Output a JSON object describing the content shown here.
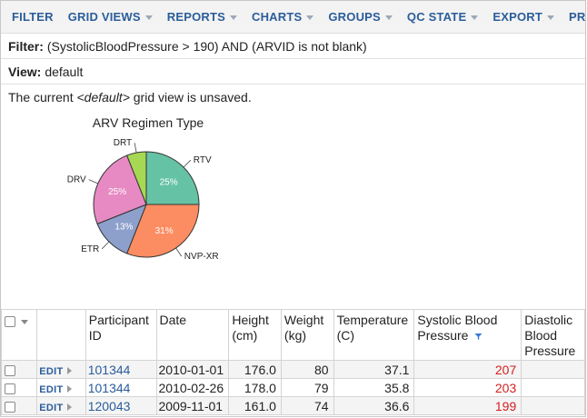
{
  "menu": [
    {
      "label": "FILTER",
      "caret": false
    },
    {
      "label": "GRID VIEWS",
      "caret": true
    },
    {
      "label": "REPORTS",
      "caret": true
    },
    {
      "label": "CHARTS",
      "caret": true
    },
    {
      "label": "GROUPS",
      "caret": true
    },
    {
      "label": "QC STATE",
      "caret": true
    },
    {
      "label": "EXPORT",
      "caret": true
    },
    {
      "label": "PRINT",
      "caret": false
    }
  ],
  "filter": {
    "label": "Filter:",
    "value": "(SystolicBloodPressure > 190) AND (ARVID is not blank)"
  },
  "view": {
    "label": "View:",
    "value": "default"
  },
  "unsaved": {
    "prefix": "The current ",
    "view_name": "<default>",
    "suffix": " grid view is unsaved."
  },
  "chart_data": {
    "type": "pie",
    "title": "ARV Regimen Type",
    "slices": [
      {
        "label": "RTV",
        "value": 25,
        "pct_label": "25%",
        "color": "#66c2a5"
      },
      {
        "label": "NVP-XR",
        "value": 31,
        "pct_label": "31%",
        "color": "#fc8d62"
      },
      {
        "label": "ETR",
        "value": 13,
        "pct_label": "13%",
        "color": "#8da0cb"
      },
      {
        "label": "DRV",
        "value": 25,
        "pct_label": "25%",
        "color": "#e78ac3"
      },
      {
        "label": "DRT",
        "value": 6,
        "pct_label": "",
        "color": "#a6d854"
      }
    ]
  },
  "grid": {
    "columns": [
      {
        "key": "select",
        "label": ""
      },
      {
        "key": "actions",
        "label": ""
      },
      {
        "key": "participant",
        "label": "Participant ID"
      },
      {
        "key": "date",
        "label": "Date"
      },
      {
        "key": "height",
        "label": "Height (cm)"
      },
      {
        "key": "weight",
        "label": "Weight (kg)"
      },
      {
        "key": "temperature",
        "label": "Temperature (C)"
      },
      {
        "key": "systolic",
        "label": "Systolic Blood Pressure"
      },
      {
        "key": "diastolic",
        "label": "Diastolic Blood Pressure"
      }
    ],
    "edit_label": "EDIT",
    "rows": [
      {
        "participant": "101344",
        "date": "2010-01-01",
        "height": "176.0",
        "weight": "80",
        "temperature": "37.1",
        "systolic": "207"
      },
      {
        "participant": "101344",
        "date": "2010-02-26",
        "height": "178.0",
        "weight": "79",
        "temperature": "35.8",
        "systolic": "203"
      },
      {
        "participant": "120043",
        "date": "2009-11-01",
        "height": "161.0",
        "weight": "74",
        "temperature": "36.6",
        "systolic": "199"
      }
    ]
  },
  "colors": {
    "link": "#2a5d9a",
    "alert_value": "#d42020",
    "menubar_bg": "#f3f3f3"
  }
}
